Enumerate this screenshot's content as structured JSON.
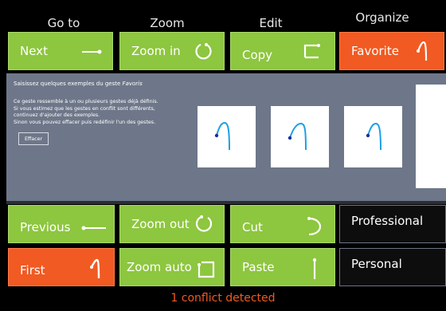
{
  "headers": [
    "Go to",
    "Zoom",
    "Edit",
    "Organize"
  ],
  "row1": [
    "Next",
    "Zoom in",
    "Copy",
    "Favorite"
  ],
  "panel": {
    "title_prefix": "Saisissez quelques exemples du geste ",
    "title_gesture": "Favoris",
    "description": [
      "Ce geste ressemble à un ou plusieurs gestes déjà définis.",
      "Si vous estimez que les gestes en conflit sont différents,",
      "continuez d'ajouter des exemples.",
      "Sinon vous pouvez effacer puis redéfinir l'un des gestes."
    ],
    "clear_label": "Effacer"
  },
  "row2": [
    "Previous",
    "Zoom out",
    "Cut",
    "Professional"
  ],
  "row3": [
    "First",
    "Zoom auto",
    "Paste",
    "Personal"
  ],
  "status": "1 conflict detected",
  "colors": {
    "green": "#8dc63f",
    "orange": "#f15a22",
    "panel": "#6e7789"
  }
}
